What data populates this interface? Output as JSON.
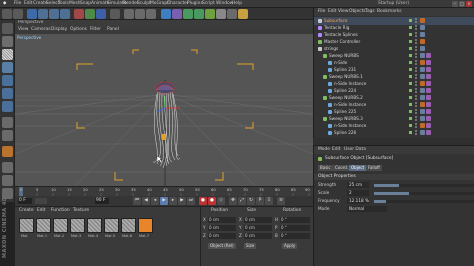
{
  "app": {
    "title": "Cinema 4D"
  },
  "menu": [
    "File",
    "Edit",
    "Create",
    "Select",
    "Tools",
    "Mesh",
    "Snap",
    "Animate",
    "Simulate",
    "Render",
    "Sculpt",
    "MoGraph",
    "Character",
    "Plugins",
    "Script",
    "Window",
    "Help"
  ],
  "layout_label": "Startup (User)",
  "viewport": {
    "title": "Perspective",
    "menu": [
      "View",
      "Cameras",
      "Display",
      "Options",
      "Filter",
      "Panel"
    ],
    "label": "Perspective"
  },
  "timeline": {
    "ticks": [
      "0",
      "5",
      "10",
      "15",
      "20",
      "25",
      "30",
      "35",
      "40",
      "45",
      "50",
      "55",
      "60",
      "65",
      "70",
      "75",
      "80",
      "85",
      "90"
    ],
    "current_frame": "0 F"
  },
  "transport": {
    "start": "0 F",
    "end": "90 F",
    "current": "0 F",
    "max": "90 F"
  },
  "material_manager": {
    "menu": [
      "Create",
      "Edit",
      "Function",
      "Texture"
    ],
    "materials": [
      "Mat",
      "Mat.1",
      "Mat.2",
      "Mat.3",
      "Mat.4",
      "Mat.5",
      "Mat.6",
      "Mat.7"
    ]
  },
  "maxon_logo": "MAXON CINEMA 4D",
  "coordinates": {
    "headers": [
      "Position",
      "Size",
      "Rotation"
    ],
    "rows": [
      {
        "axis": "X",
        "pos": "0 cm",
        "size_axis": "X",
        "size": "0 cm",
        "rot_axis": "H",
        "rot": "0 °"
      },
      {
        "axis": "Y",
        "pos": "0 cm",
        "size_axis": "Y",
        "size": "0 cm",
        "rot_axis": "P",
        "rot": "0 °"
      },
      {
        "axis": "Z",
        "pos": "0 cm",
        "size_axis": "Z",
        "size": "0 cm",
        "rot_axis": "B",
        "rot": "0 °"
      }
    ],
    "mode_select": "Object (Rel)",
    "size_select": "Size",
    "apply": "Apply"
  },
  "object_manager": {
    "menu": [
      "File",
      "Edit",
      "View",
      "Objects",
      "Tags",
      "Bookmarks"
    ],
    "objects": [
      {
        "name": "Subsurface",
        "level": 0,
        "color": "#c9c9c9",
        "selected": true
      },
      {
        "name": "Tentacle Rig",
        "level": 0,
        "color": "#b388ff",
        "selected": false
      },
      {
        "name": "Tentacle Splines",
        "level": 0,
        "color": "#b388ff",
        "selected": false
      },
      {
        "name": "Master Controller",
        "level": 0,
        "color": "#7fbf5f",
        "selected": false
      },
      {
        "name": "strings",
        "level": 0,
        "color": "#c9c9c9",
        "selected": false
      },
      {
        "name": "Sweep NURBS",
        "level": 1,
        "color": "#7fbf5f",
        "selected": false
      },
      {
        "name": "n-Side",
        "level": 2,
        "color": "#6fa8dc",
        "selected": false
      },
      {
        "name": "Spline 231",
        "level": 2,
        "color": "#6fa8dc",
        "selected": false
      },
      {
        "name": "Sweep NURBS.1",
        "level": 1,
        "color": "#7fbf5f",
        "selected": false
      },
      {
        "name": "n-Side Instance",
        "level": 2,
        "color": "#6fa8dc",
        "selected": false
      },
      {
        "name": "Spline 224",
        "level": 2,
        "color": "#6fa8dc",
        "selected": false
      },
      {
        "name": "Sweep NURBS.2",
        "level": 1,
        "color": "#7fbf5f",
        "selected": false
      },
      {
        "name": "n-Side Instance",
        "level": 2,
        "color": "#6fa8dc",
        "selected": false
      },
      {
        "name": "Spline 225",
        "level": 2,
        "color": "#6fa8dc",
        "selected": false
      },
      {
        "name": "Sweep NURBS.3",
        "level": 1,
        "color": "#7fbf5f",
        "selected": false
      },
      {
        "name": "n-Side Instance",
        "level": 2,
        "color": "#6fa8dc",
        "selected": false
      },
      {
        "name": "Spline 226",
        "level": 2,
        "color": "#6fa8dc",
        "selected": false
      }
    ]
  },
  "attribute_manager": {
    "menu": [
      "Mode",
      "Edit",
      "User Data"
    ],
    "object_title": "Subsurface Object [Subsurface]",
    "tabs": [
      "Basic",
      "Coord.",
      "Object",
      "Falloff"
    ],
    "active_tab": "Object",
    "section": "Object Properties",
    "fields": [
      {
        "label": "Strength",
        "value": "25 cm",
        "fill": 0.25
      },
      {
        "label": "Scale",
        "value": "2",
        "fill": 0.35
      },
      {
        "label": "Frequency",
        "value": "12.118 %",
        "fill": 0.12
      },
      {
        "label": "Mode",
        "value": "Normal",
        "fill": null
      }
    ]
  }
}
